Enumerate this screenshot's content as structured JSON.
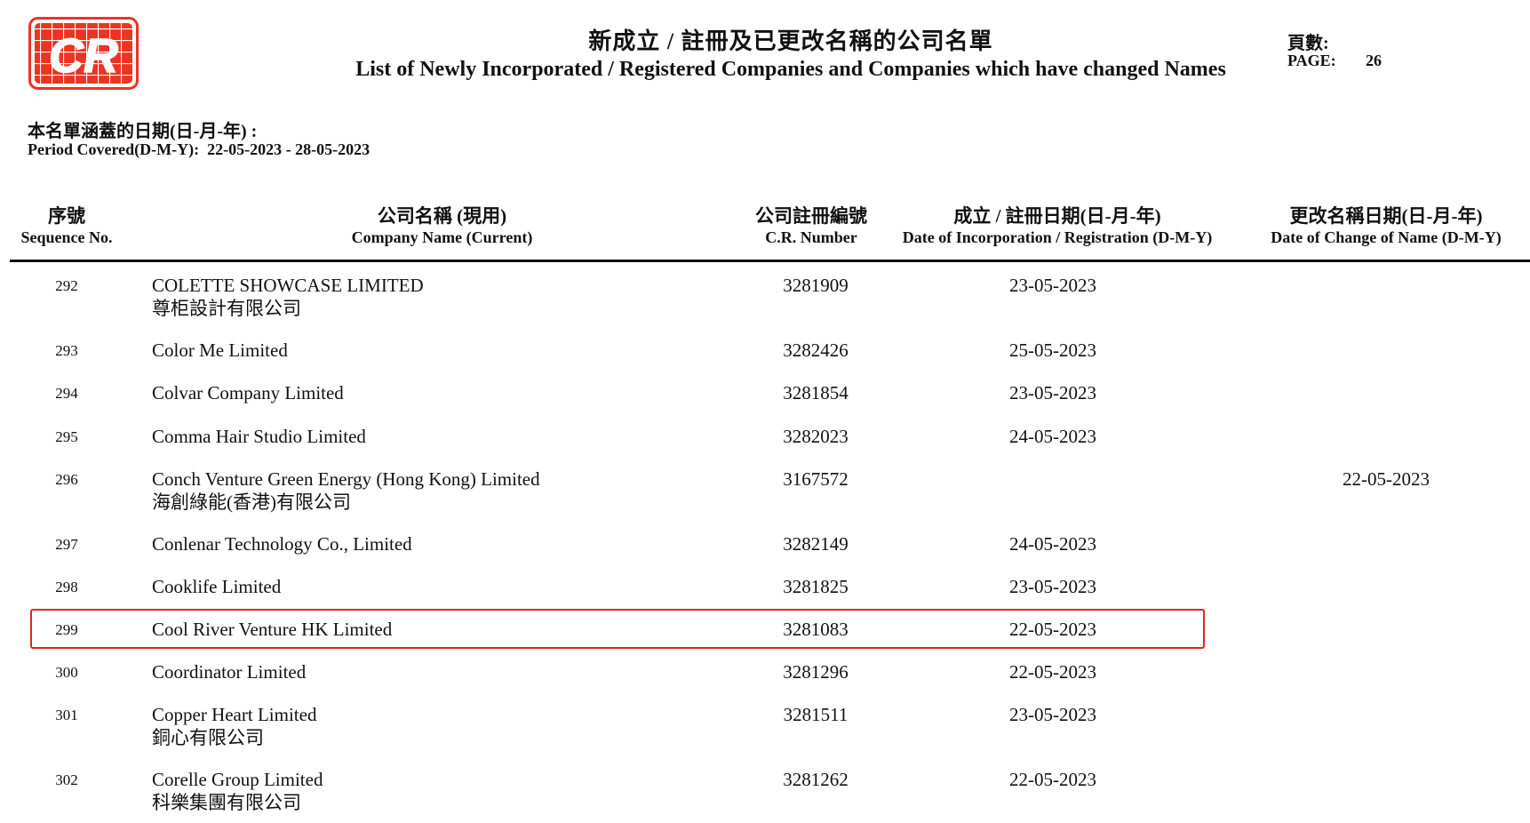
{
  "logo_text": "CR",
  "colors": {
    "logo_red": "#ee3322",
    "highlight": "#e0261c"
  },
  "header": {
    "title_zh": "新成立 / 註冊及已更改名稱的公司名單",
    "title_en": "List of Newly Incorporated / Registered Companies and Companies which have changed Names",
    "page_label_zh": "頁數:",
    "page_label_en": "PAGE:",
    "page_number": "26"
  },
  "period": {
    "label_zh": "本名單涵蓋的日期(日-月-年) :",
    "label_en": "Period Covered(D-M-Y):",
    "range": "22-05-2023 - 28-05-2023"
  },
  "columns": {
    "seq_zh": "序號",
    "seq_en": "Sequence No.",
    "name_zh": "公司名稱 (現用)",
    "name_en": "Company Name (Current)",
    "cr_zh": "公司註冊編號",
    "cr_en": "C.R. Number",
    "inc_zh": "成立 / 註冊日期(日-月-年)",
    "inc_en": "Date of Incorporation / Registration (D-M-Y)",
    "chg_zh": "更改名稱日期(日-月-年)",
    "chg_en": "Date of Change of Name (D-M-Y)"
  },
  "rows": [
    {
      "seq": "292",
      "name_en": "COLETTE SHOWCASE LIMITED",
      "name_zh": "尊柜設計有限公司",
      "cr": "3281909",
      "inc_date": "23-05-2023",
      "chg_date": ""
    },
    {
      "seq": "293",
      "name_en": "Color Me Limited",
      "name_zh": "",
      "cr": "3282426",
      "inc_date": "25-05-2023",
      "chg_date": ""
    },
    {
      "seq": "294",
      "name_en": "Colvar Company Limited",
      "name_zh": "",
      "cr": "3281854",
      "inc_date": "23-05-2023",
      "chg_date": ""
    },
    {
      "seq": "295",
      "name_en": "Comma Hair Studio Limited",
      "name_zh": "",
      "cr": "3282023",
      "inc_date": "24-05-2023",
      "chg_date": ""
    },
    {
      "seq": "296",
      "name_en": "Conch Venture Green Energy (Hong Kong) Limited",
      "name_zh": "海創綠能(香港)有限公司",
      "cr": "3167572",
      "inc_date": "",
      "chg_date": "22-05-2023"
    },
    {
      "seq": "297",
      "name_en": "Conlenar Technology Co., Limited",
      "name_zh": "",
      "cr": "3282149",
      "inc_date": "24-05-2023",
      "chg_date": ""
    },
    {
      "seq": "298",
      "name_en": "Cooklife Limited",
      "name_zh": "",
      "cr": "3281825",
      "inc_date": "23-05-2023",
      "chg_date": ""
    },
    {
      "seq": "299",
      "name_en": "Cool River Venture HK Limited",
      "name_zh": "",
      "cr": "3281083",
      "inc_date": "22-05-2023",
      "chg_date": ""
    },
    {
      "seq": "300",
      "name_en": "Coordinator Limited",
      "name_zh": "",
      "cr": "3281296",
      "inc_date": "22-05-2023",
      "chg_date": ""
    },
    {
      "seq": "301",
      "name_en": "Copper Heart Limited",
      "name_zh": "銅心有限公司",
      "cr": "3281511",
      "inc_date": "23-05-2023",
      "chg_date": ""
    },
    {
      "seq": "302",
      "name_en": "Corelle Group Limited",
      "name_zh": "科樂集團有限公司",
      "cr": "3281262",
      "inc_date": "22-05-2023",
      "chg_date": ""
    }
  ]
}
